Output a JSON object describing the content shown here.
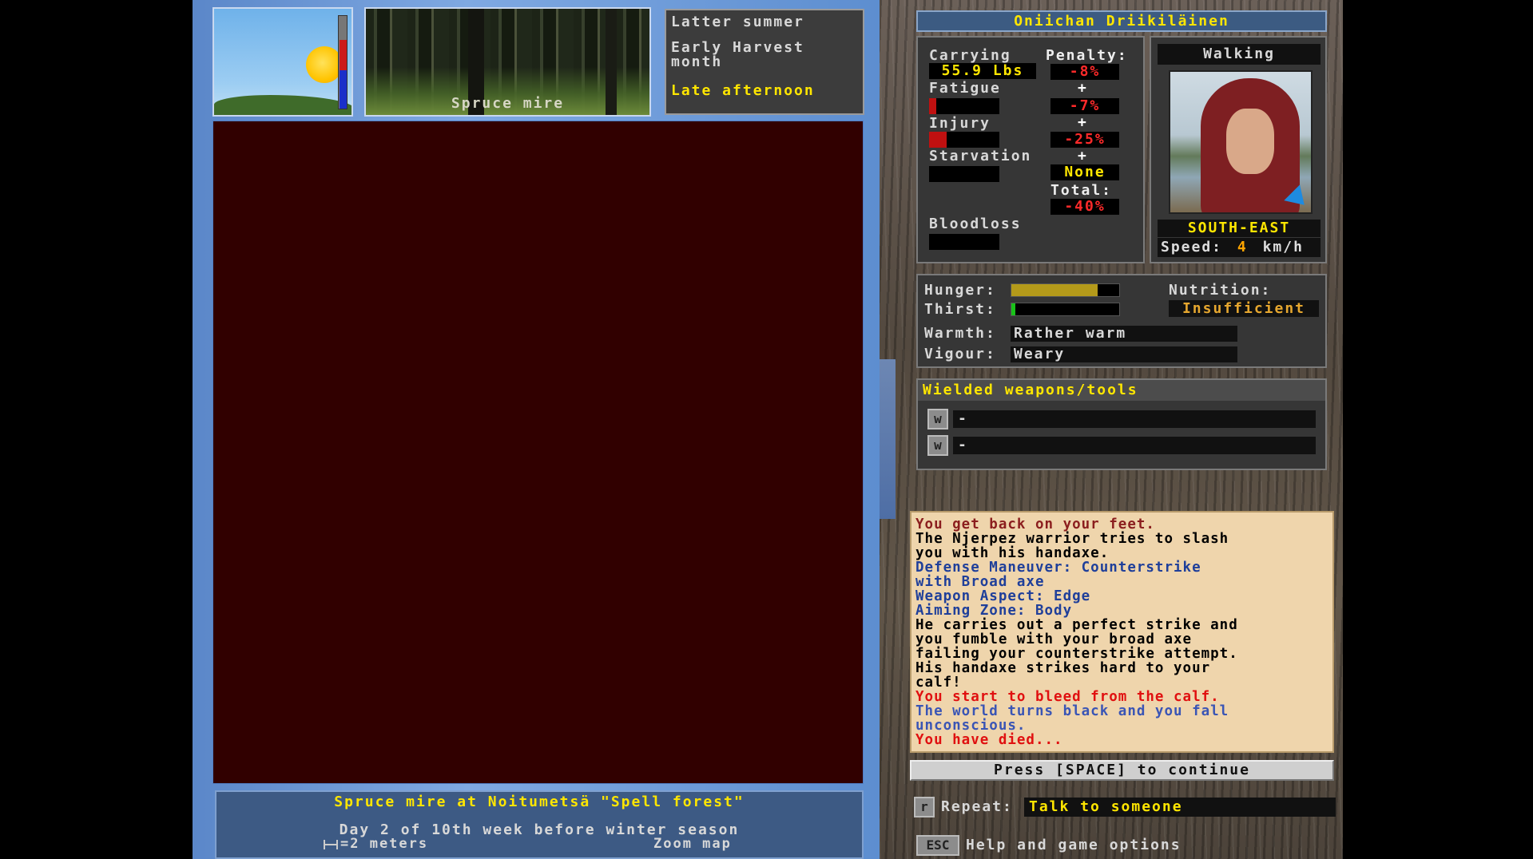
{
  "top": {
    "location_thumb_label": "Spruce mire",
    "season": "Latter summer",
    "month": "Early Harvest month",
    "time_of_day": "Late afternoon"
  },
  "map_footer": {
    "location_line": "Spruce mire at Noitumetsä \"Spell forest\"",
    "date_line": "Day 2 of 10th week before winter season",
    "scale_label": "=2 meters",
    "zoom_label": "Zoom map"
  },
  "character": {
    "name": "Oniichan Driikiläinen",
    "movement_mode": "Walking",
    "direction": "SOUTH-EAST",
    "speed_label": "Speed:",
    "speed_value": "4",
    "speed_unit": "km/h"
  },
  "status": {
    "carrying_label": "Carrying",
    "carrying_value": "55.9 Lbs",
    "penalty_label": "Penalty:",
    "carry_penalty": "-8%",
    "fatigue_label": "Fatigue",
    "fatigue_level": 0.1,
    "fatigue_penalty": "-7%",
    "injury_label": "Injury",
    "injury_level": 0.25,
    "injury_penalty": "-25%",
    "starvation_label": "Starvation",
    "starvation_level": 0,
    "starvation_penalty": "None",
    "total_label": "Total:",
    "total_penalty": "-40%",
    "bloodloss_label": "Bloodloss",
    "bloodloss_level": 0,
    "plus": "+"
  },
  "needs": {
    "hunger_label": "Hunger:",
    "hunger_level": 0.8,
    "thirst_label": "Thirst:",
    "thirst_level": 0.04,
    "nutrition_label": "Nutrition:",
    "nutrition_value": "Insufficient",
    "warmth_label": "Warmth:",
    "warmth_value": "Rather warm",
    "vigour_label": "Vigour:",
    "vigour_value": "Weary"
  },
  "weapons": {
    "title": "Wielded weapons/tools",
    "slots": [
      {
        "key": "w",
        "value": "-"
      },
      {
        "key": "w",
        "value": "-"
      }
    ]
  },
  "log": [
    {
      "text": "You get back on your feet.",
      "color": "#8b1e1e"
    },
    {
      "text": "The Njerpez warrior tries to slash",
      "color": "#000000"
    },
    {
      "text": "you with his handaxe.",
      "color": "#000000"
    },
    {
      "text": "Defense Maneuver: Counterstrike",
      "color": "#1f3f9a"
    },
    {
      "text": "with Broad axe",
      "color": "#1f3f9a"
    },
    {
      "text": "Weapon Aspect: Edge",
      "color": "#1f3f9a"
    },
    {
      "text": "Aiming Zone: Body",
      "color": "#1f3f9a"
    },
    {
      "text": "He carries out a perfect strike and",
      "color": "#000000"
    },
    {
      "text": "you fumble with your broad axe",
      "color": "#000000"
    },
    {
      "text": "failing your counterstrike attempt.",
      "color": "#000000"
    },
    {
      "text": "His handaxe strikes hard to your",
      "color": "#000000"
    },
    {
      "text": "calf!",
      "color": "#000000"
    },
    {
      "text": "You start to bleed from the calf.",
      "color": "#e01010"
    },
    {
      "text": "The world turns black and you fall",
      "color": "#3a55b5"
    },
    {
      "text": "unconscious.",
      "color": "#3a55b5"
    },
    {
      "text": "You have died...",
      "color": "#e01010"
    }
  ],
  "prompt": "Press [SPACE] to continue",
  "repeat": {
    "key": "r",
    "label": "Repeat:",
    "value": "Talk to someone"
  },
  "help": {
    "key": "ESC",
    "label": "Help and game options"
  },
  "colors": {
    "map_bg": "#310000",
    "log_bg": "#efd5ac",
    "yellow": "#ffe600",
    "penalty_red": "#ff2a2a",
    "hunger_bar": "#b49a1a",
    "thirst_bar": "#19c219",
    "injury_bar": "#c01010"
  }
}
